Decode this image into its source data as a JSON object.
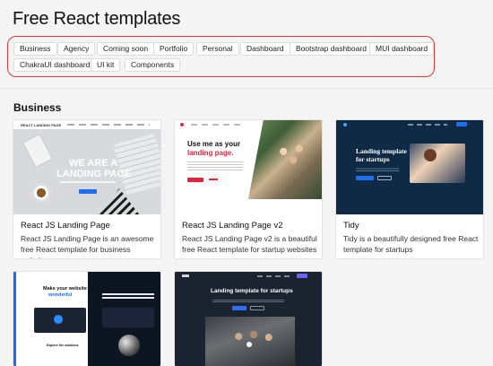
{
  "page": {
    "title": "Free React templates"
  },
  "filters": [
    "Business",
    "Agency",
    "Coming soon",
    "Portfolio",
    "Personal",
    "Dashboard",
    "Bootstrap dashboard",
    "MUI dashboard",
    "ChakraUI dashboard",
    "UI kit",
    "Components"
  ],
  "section": {
    "title": "Business"
  },
  "cards": [
    {
      "title": "React JS Landing Page",
      "description": "React JS Landing Page is an awesome free React template for business websites",
      "thumb": {
        "brand": "REACT LANDING PAGE",
        "headline_1": "WE ARE A",
        "headline_2": "LANDING PAGE"
      }
    },
    {
      "title": "React JS Landing Page v2",
      "description": "React JS Landing Page v2 is a beautiful free React template for startup websites",
      "thumb": {
        "headline_1": "Use me as your",
        "headline_2": "landing page."
      }
    },
    {
      "title": "Tidy",
      "description": "Tidy is a beautifully designed free React template for startups",
      "thumb": {
        "headline_1": "Landing template",
        "headline_2": "for startups"
      }
    },
    {
      "thumb": {
        "headline_1": "Make your website",
        "headline_2": "wonderful",
        "sub": "Explore the solutions"
      }
    },
    {
      "thumb": {
        "headline_1": "Landing template for startups"
      }
    }
  ],
  "colors": {
    "accent_red": "#d63a3a",
    "blue": "#1e6ef0",
    "navy": "#0f2a44"
  }
}
